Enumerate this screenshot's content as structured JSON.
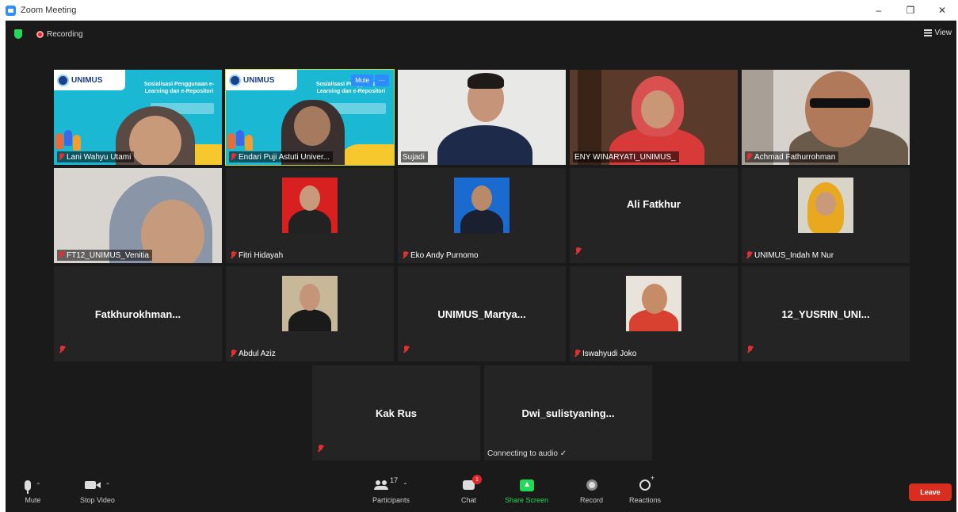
{
  "window": {
    "title": "Zoom Meeting",
    "controls": [
      "–",
      "❐",
      "✕"
    ]
  },
  "topbar": {
    "recording_label": "Recording",
    "view_label": "View"
  },
  "tiles": {
    "t1": {
      "name": "Lani Wahyu Utami",
      "slide_logo": "UNIMUS",
      "slide_title": "Sosialisasi Penggunaan e-Learning dan e-Repositori"
    },
    "t2": {
      "name": "Endari Puji Astuti Univer...",
      "slide_logo": "UNIMUS",
      "slide_title": "Sosialisasi Penggunaan e-Learning dan e-Repositori",
      "mute_label": "Mute",
      "more_label": "···"
    },
    "t3": {
      "name": "Sujadi"
    },
    "t4": {
      "name": "ENY WINARYATI_UNIMUS_"
    },
    "t5": {
      "name": "Achmad Fathurrohman"
    },
    "t6": {
      "name": "FT12_UNIMUS_Venitia"
    },
    "t7": {
      "name": "Fitri Hidayah"
    },
    "t8": {
      "name": "Eko Andy Purnomo"
    },
    "t9": {
      "center": "Ali Fatkhur"
    },
    "t10": {
      "name": "UNIMUS_Indah M Nur"
    },
    "t11": {
      "center": "Fatkhurokhman..."
    },
    "t12": {
      "name": "Abdul Aziz"
    },
    "t13": {
      "center": "UNIMUS_Martya..."
    },
    "t14": {
      "name": "Iswahyudi Joko"
    },
    "t15": {
      "center": "12_YUSRIN_UNI..."
    },
    "t16": {
      "center": "Kak Rus"
    },
    "t17": {
      "center": "Dwi_sulistyaning...",
      "status": "Connecting to audio ✓"
    }
  },
  "toolbar": {
    "mute_label": "Mute",
    "stop_video_label": "Stop Video",
    "participants_label": "Participants",
    "participants_count": "17",
    "chat_label": "Chat",
    "chat_badge": "1",
    "share_label": "Share Screen",
    "record_label": "Record",
    "reactions_label": "Reactions",
    "leave_label": "Leave"
  },
  "colors": {
    "background": "#1a1a1a",
    "tile": "#242424",
    "active_speaker": "#c9e33a",
    "share_green": "#23d959",
    "leave_red": "#d92d20",
    "zoom_blue": "#2d8cff"
  }
}
